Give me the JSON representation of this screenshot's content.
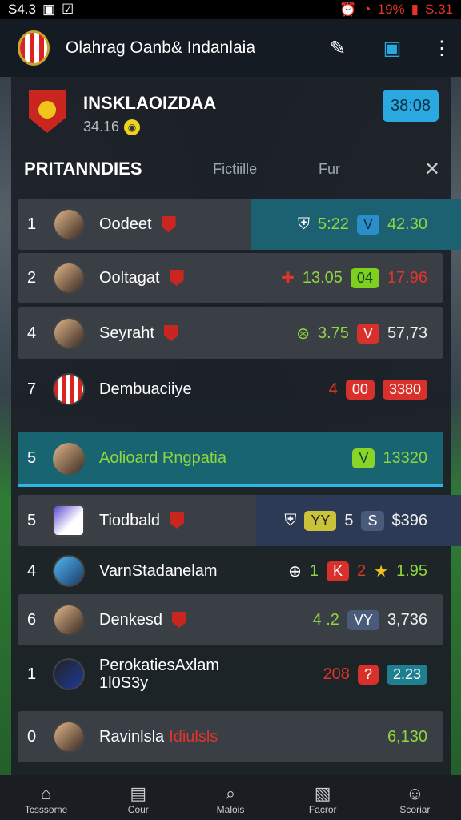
{
  "status": {
    "time_left": "S4.3",
    "battery": "19%",
    "time_right": "S.31"
  },
  "appbar": {
    "title": "Olahrag Oanb& Indanlaia"
  },
  "team": {
    "name": "INSKLAOIZDAA",
    "sub": "34.16",
    "score_button": "38:08"
  },
  "tabs": {
    "active": "PRITANNDIES",
    "tab2": "Fictiille",
    "tab3": "Fur"
  },
  "rows": [
    {
      "rank": "1",
      "name": "Oodeet",
      "v1": "5:22",
      "tag": "V",
      "v2": "42.30"
    },
    {
      "rank": "2",
      "name": "Ooltagat",
      "v1": "13.05",
      "tag": "04",
      "v2": "17.96"
    },
    {
      "rank": "4",
      "name": "Seyraht",
      "v1": "3.75",
      "tag": "V",
      "v2": "57,73"
    },
    {
      "rank": "7",
      "name": "Dembuaciiye",
      "v1": "4",
      "tag": "00",
      "v2": "3380"
    },
    {
      "rank": "5",
      "name": "Aolioard Rngpatia",
      "tag": "V",
      "v2": "13320"
    },
    {
      "rank": "5",
      "name": "Tiodbald",
      "tag": "YY",
      "v1": "5",
      "tag2": "S",
      "v2": "$396"
    },
    {
      "rank": "4",
      "name": "VarnStadanelam",
      "v1": "1",
      "tag": "K",
      "v3": "2",
      "v2": "1.95"
    },
    {
      "rank": "6",
      "name": "Denkesd",
      "v1": "4 .2",
      "tag": "VY",
      "v2": "3,736"
    },
    {
      "rank": "1",
      "name": "PerokatiesAxlam",
      "name2": "1l0S3y",
      "v1": "208",
      "tag": "?",
      "v2": "2.23"
    },
    {
      "rank": "0",
      "name": "Ravinlsla",
      "name_red": "Idiulsls",
      "v2": "6,130"
    }
  ],
  "nav": [
    {
      "label": "Tcsssome",
      "icon": "home-icon"
    },
    {
      "label": "Cour",
      "icon": "screen-icon"
    },
    {
      "label": "Malois",
      "icon": "search-icon"
    },
    {
      "label": "Facror",
      "icon": "clipboard-icon"
    },
    {
      "label": "Scoriar",
      "icon": "person-icon"
    }
  ]
}
